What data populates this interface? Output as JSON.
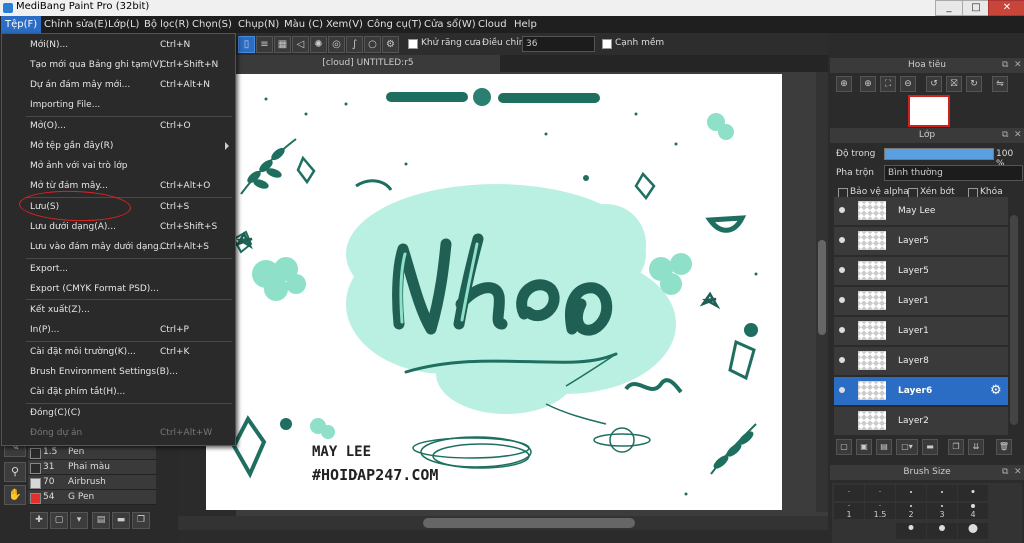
{
  "window": {
    "title": "MediBang Paint Pro (32bit)",
    "controls": [
      "_",
      "□",
      "✕"
    ]
  },
  "menubar": {
    "items": [
      "Tệp(F)",
      "Chỉnh sửa(E)",
      "Lớp(L)",
      "Bộ lọc(R)",
      "Chọn(S)",
      "Chụp(N)",
      "Màu (C)",
      "Xem(V)",
      "Công cụ(T)",
      "Cửa sổ(W)",
      "Cloud",
      "Help"
    ],
    "active_index": 0
  },
  "toolbar": {
    "antialias_label": "Khử răng cưa",
    "adjust_label": "Điều chỉnh",
    "adjust_value": "36",
    "edge_label": "Cạnh mềm"
  },
  "tab": {
    "title": "[cloud] UNTITLED:r5"
  },
  "file_menu": {
    "items": [
      {
        "label": "Mới(N)...",
        "shortcut": "Ctrl+N"
      },
      {
        "label": "Tạo mới qua Bảng ghi tạm(V)",
        "shortcut": "Ctrl+Shift+N"
      },
      {
        "label": "Dự án đám mây mới...",
        "shortcut": "Ctrl+Alt+N"
      },
      {
        "label": "Importing File...",
        "shortcut": ""
      },
      {
        "label": "Mở(O)...",
        "shortcut": "Ctrl+O"
      },
      {
        "label": "Mở tệp gần đây(R)",
        "shortcut": ""
      },
      {
        "label": "Mở ảnh với vai trò lớp",
        "shortcut": ""
      },
      {
        "label": "Mở từ đám mây...",
        "shortcut": "Ctrl+Alt+O"
      },
      {
        "label": "Lưu(S)",
        "shortcut": "Ctrl+S"
      },
      {
        "label": "Lưu dưới dạng(A)...",
        "shortcut": "Ctrl+Shift+S"
      },
      {
        "label": "Lưu vào đám mây dưới dạng...",
        "shortcut": "Ctrl+Alt+S"
      },
      {
        "label": "Export...",
        "shortcut": ""
      },
      {
        "label": "Export (CMYK Format PSD)...",
        "shortcut": ""
      },
      {
        "label": "Kết xuất(Z)...",
        "shortcut": ""
      },
      {
        "label": "In(P)...",
        "shortcut": "Ctrl+P"
      },
      {
        "label": "Cài đặt môi trường(K)...",
        "shortcut": "Ctrl+K"
      },
      {
        "label": "Brush Environment Settings(B)...",
        "shortcut": ""
      },
      {
        "label": "Cài đặt phím tắt(H)...",
        "shortcut": ""
      },
      {
        "label": "Đóng(C)(C)",
        "shortcut": ""
      },
      {
        "label": "Đóng dự án",
        "shortcut": "Ctrl+Alt+W"
      }
    ]
  },
  "brushes": [
    {
      "size": "1.5",
      "name": "Pen",
      "color": "#2b2b2b"
    },
    {
      "size": "31",
      "name": "Phai màu",
      "color": "#2b2b2b"
    },
    {
      "size": "70",
      "name": "Airbrush",
      "color": "#d8d8d8"
    },
    {
      "size": "54",
      "name": "G Pen",
      "color": "#e03030"
    }
  ],
  "navigator": {
    "title": "Hoa tiêu"
  },
  "layers_panel": {
    "title": "Lớp",
    "opacity_label": "Độ trong",
    "opacity_value": "100 %",
    "blend_label": "Pha trộn",
    "blend_value": "Bình thường",
    "protect_alpha": "Bảo vệ alpha",
    "clipping": "Xén bớt",
    "lock": "Khóa",
    "layers": [
      "May Lee",
      "Layer5",
      "Layer5",
      "Layer1",
      "Layer1",
      "Layer8",
      "Layer6",
      "Layer2"
    ],
    "selected_index": 6
  },
  "brush_size": {
    "title": "Brush Size",
    "sizes": [
      "1",
      "1.5",
      "2",
      "3",
      "4"
    ]
  },
  "canvas_text": {
    "title": "Nhớ",
    "author": "MAY LEE",
    "site": "#HOIDAP247.COM"
  },
  "colors": {
    "accent": "#2b6cc4",
    "teal": "#1f6f60",
    "mint": "#8fe0c8"
  }
}
